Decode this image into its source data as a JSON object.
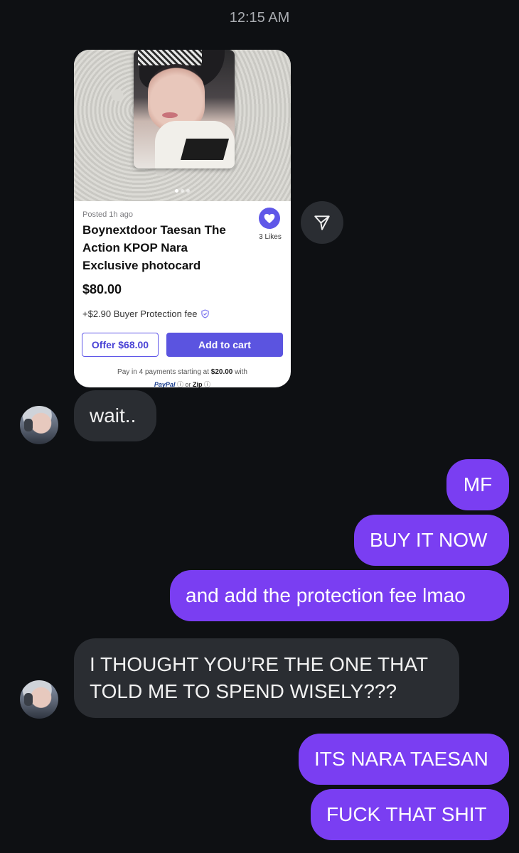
{
  "timestamp": "12:15 AM",
  "listing": {
    "posted": "Posted 1h ago",
    "title": "Boynextdoor Taesan The Action KPOP Nara Exclusive photocard",
    "likes": "3 Likes",
    "price": "$80.00",
    "fee": "+$2.90 Buyer Protection fee",
    "offer_label": "Offer $68.00",
    "cart_label": "Add to cart",
    "pay_prefix": "Pay in 4 payments starting at ",
    "pay_amount": "$20.00",
    "pay_suffix": " with",
    "paypal": "PayPal",
    "or": "or",
    "zip": "Zip",
    "image_count": 3,
    "active_image": 1,
    "accent_color": "#5f57e8"
  },
  "messages": [
    {
      "side": "incoming",
      "text": "wait.."
    },
    {
      "side": "outgoing",
      "text": "MF"
    },
    {
      "side": "outgoing",
      "text": "BUY IT NOW"
    },
    {
      "side": "outgoing",
      "text": "and add the protection fee lmao"
    },
    {
      "side": "incoming",
      "text": "I THOUGHT YOU’RE THE ONE THAT TOLD ME TO SPEND WISELY???"
    },
    {
      "side": "outgoing",
      "text": "ITS NARA TAESAN"
    },
    {
      "side": "outgoing",
      "text": "FUCK THAT SHIT"
    }
  ],
  "colors": {
    "background": "#0e1013",
    "incoming_bubble": "#2a2d32",
    "outgoing_bubble": "#7a3ef2"
  }
}
